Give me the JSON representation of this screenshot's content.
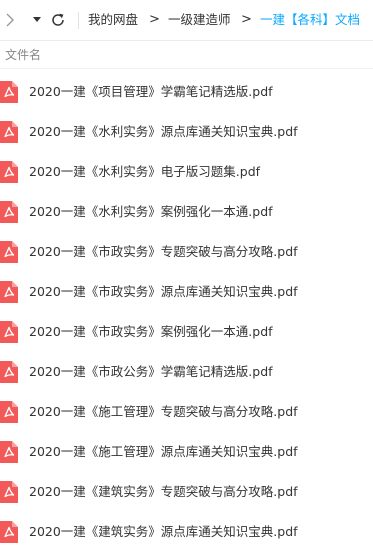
{
  "toolbar": {
    "forward_icon": "chevron-right-icon",
    "dropdown_icon": "caret-down-icon",
    "refresh_icon": "refresh-icon"
  },
  "breadcrumb": {
    "items": [
      "我的网盘",
      "一级建造师",
      "一建【各科】文档"
    ],
    "separator": ">",
    "current_color": "#09aaff"
  },
  "list": {
    "column_header": "文件名",
    "icon": "pdf-icon",
    "icon_color": "#f25a5a",
    "files": [
      "2020一建《项目管理》学霸笔记精选版.pdf",
      "2020一建《水利实务》源点库通关知识宝典.pdf",
      "2020一建《水利实务》电子版习题集.pdf",
      "2020一建《水利实务》案例强化一本通.pdf",
      "2020一建《市政实务》专题突破与高分攻略.pdf",
      "2020一建《市政实务》源点库通关知识宝典.pdf",
      "2020一建《市政实务》案例强化一本通.pdf",
      "2020一建《市政公务》学霸笔记精选版.pdf",
      "2020一建《施工管理》专题突破与高分攻略.pdf",
      "2020一建《施工管理》源点库通关知识宝典.pdf",
      "2020一建《建筑实务》专题突破与高分攻略.pdf",
      "2020一建《建筑实务》源点库通关知识宝典.pdf"
    ]
  }
}
